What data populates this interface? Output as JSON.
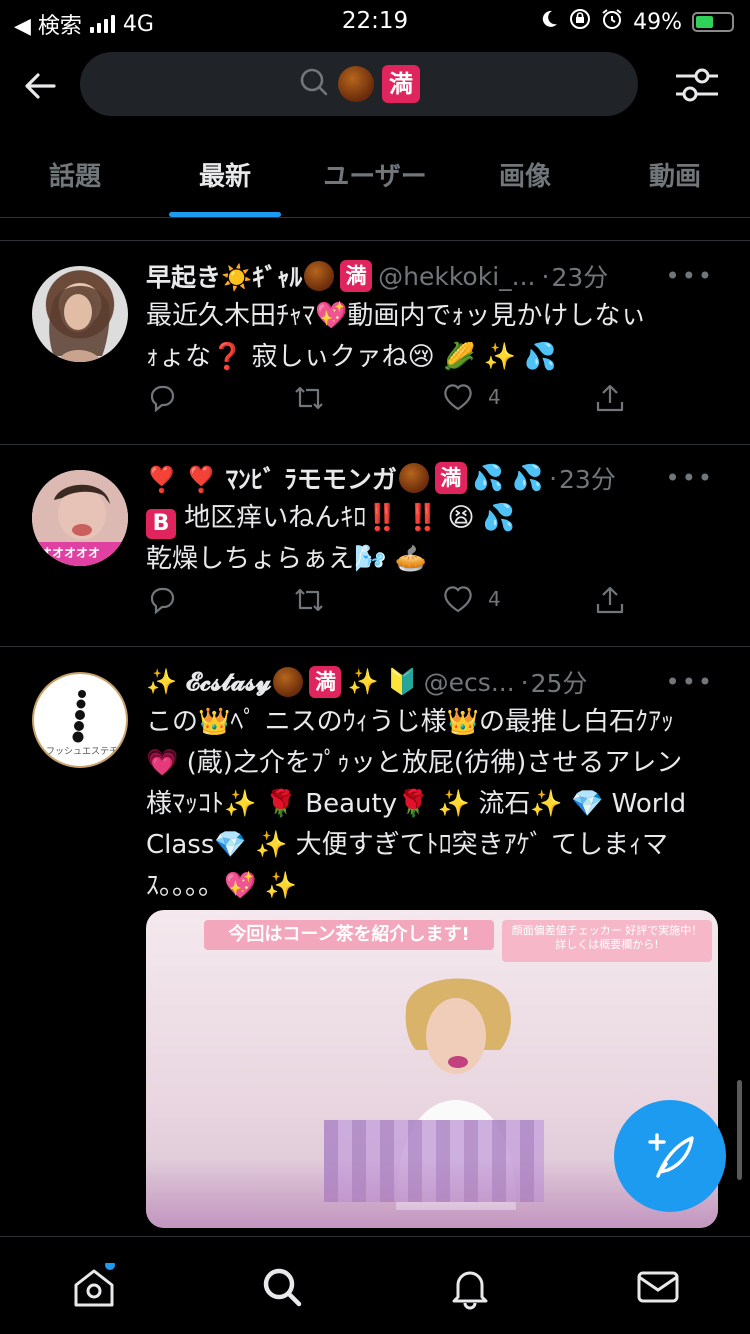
{
  "status": {
    "carrier": "◀ 検索",
    "network": "4G",
    "time": "22:19",
    "battery_percent": "49%",
    "battery_level": 0.49
  },
  "search": {
    "query_badge": "満"
  },
  "tabs": [
    {
      "label": "話題"
    },
    {
      "label": "最新"
    },
    {
      "label": "ユーザー"
    },
    {
      "label": "画像"
    },
    {
      "label": "動画"
    }
  ],
  "active_tab": "最新",
  "tweets": [
    {
      "name": "早起き☀️ｷﾞｬﾙ",
      "badge": "満",
      "handle": "@hekkoki_...",
      "dot": "·",
      "time": "23分",
      "text": "最近久木田ﾁｬﾏ💖動画内でｫッ見かけしなぃ\nｫょな❓ 寂しぃクァね😢 🌽 ✨ 💦",
      "likes": "4"
    },
    {
      "name_prefix": "❣️ ❣️ ﾏﾝﾋﾞ ﾗモモンガ",
      "badge": "満",
      "name_suffix": "💦 💦",
      "dot": "·",
      "time": "23分",
      "b_badge": "B",
      "text1": "地区痒いねんｷﾛ‼️ ‼️ 😫 💦",
      "text2": "乾燥しちょらぁえ🌬️ 🥧",
      "likes": "4"
    },
    {
      "name_prefix": "✨ 𝓔𝓬𝓼𝓽𝓪𝓼𝔂",
      "badge": "満",
      "name_suffix": "✨ 🔰",
      "handle": "@ecs...",
      "dot": "·",
      "time": "25分",
      "text": "この👑ﾍﾟ ニスのｳｨうじ様👑の最推し白石ｸｱｯ\n💗 (蔵)之介をﾌﾟｩッと放屁(彷彿)させるアレン\n様ﾏｯｺﾄ✨ 🌹 Beauty🌹 ✨ 流石✨ 💎 World\nClass💎 ✨ 大便すぎてﾄﾛ突きｱｹﾞ てしまｨマ\nｽ。。。。💖 ✨",
      "media_banner": "今回はコーン茶を紹介します!",
      "media_banner2": "顔面偏差値チェッカー 好評で実施中！\n詳しくは概要欄から!"
    }
  ],
  "avatar3_text": "フッシュエステチッ",
  "avatar2_text": "オオオオオ"
}
